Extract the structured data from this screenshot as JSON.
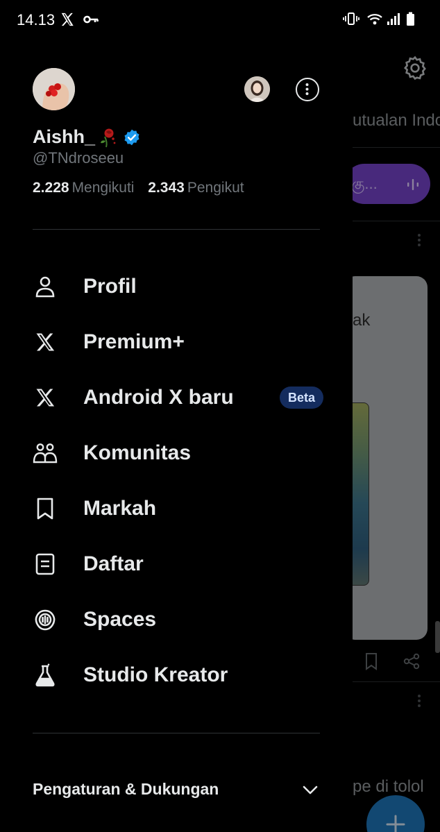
{
  "status_bar": {
    "time": "14.13"
  },
  "profile": {
    "display_name": "Aishh_",
    "handle": "@TNdroseeu",
    "following_count": "2.228",
    "following_label": "Mengikuti",
    "followers_count": "2.343",
    "followers_label": "Pengikut"
  },
  "menu": {
    "items": [
      {
        "label": "Profil",
        "icon": "person-icon"
      },
      {
        "label": "Premium+",
        "icon": "x-logo-icon"
      },
      {
        "label": "Android X baru",
        "icon": "x-logo-icon",
        "badge": "Beta"
      },
      {
        "label": "Komunitas",
        "icon": "communities-icon"
      },
      {
        "label": "Markah",
        "icon": "bookmark-icon"
      },
      {
        "label": "Daftar",
        "icon": "list-icon"
      },
      {
        "label": "Spaces",
        "icon": "spaces-icon"
      },
      {
        "label": "Studio Kreator",
        "icon": "flask-icon"
      }
    ]
  },
  "settings_section": {
    "label": "Pengaturan & Dukungan"
  },
  "background": {
    "tab_text": "utualan Indo",
    "pill_text": "கு...",
    "card_text": "ak",
    "footer_text": "pe di tolol"
  },
  "colors": {
    "background": "#000000",
    "text_primary": "#e7e9ea",
    "text_secondary": "#71767b",
    "verified_blue": "#1d9bf0",
    "beta_badge_bg": "#142c5e",
    "spaces_pill": "#6f3fbf"
  }
}
